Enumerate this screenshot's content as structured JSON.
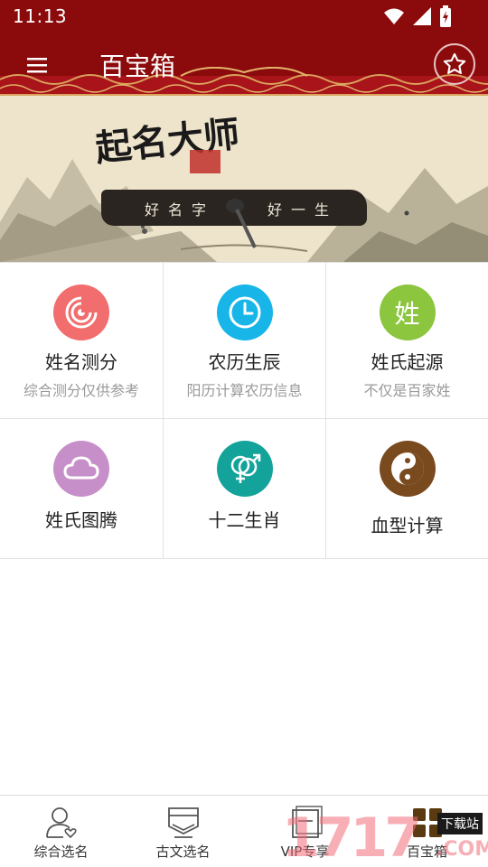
{
  "status_bar": {
    "time": "11:13",
    "icons": [
      "wifi-icon",
      "signal-icon",
      "battery-charging-icon"
    ]
  },
  "app_bar": {
    "title": "百宝箱",
    "menu_icon": "hamburger-menu-icon",
    "favorite_icon": "star-icon"
  },
  "banner": {
    "calligraphy": "起名大师",
    "slogan_left": "好名字",
    "slogan_right": "好一生"
  },
  "tools": [
    {
      "label": "姓名测分",
      "sub": "综合测分仅供参考",
      "icon": "target-icon",
      "color": "#f26d6d"
    },
    {
      "label": "农历生辰",
      "sub": "阳历计算农历信息",
      "icon": "clock-icon",
      "color": "#17b5e8"
    },
    {
      "label": "姓氏起源",
      "sub": "不仅是百家姓",
      "icon": "surname-char-icon",
      "icon_text": "姓",
      "color": "#8cc63f"
    },
    {
      "label": "姓氏图腾",
      "sub": "",
      "icon": "cloud-icon",
      "color": "#c78fc9"
    },
    {
      "label": "十二生肖",
      "sub": "",
      "icon": "gender-symbols-icon",
      "color": "#14a39a"
    },
    {
      "label": "血型计算",
      "sub": "",
      "icon": "yin-yang-icon",
      "color": "#7a4a1f"
    }
  ],
  "bottom_nav": [
    {
      "label": "综合选名",
      "icon": "user-heart-icon"
    },
    {
      "label": "古文选名",
      "icon": "scroll-icon"
    },
    {
      "label": "VIP专享",
      "icon": "vip-book-icon"
    },
    {
      "label": "百宝箱",
      "icon": "toolbox-grid-icon",
      "active": true
    }
  ],
  "watermark": {
    "text": "1717",
    "site_text": "下载站",
    "suffix": ".COM"
  },
  "colors": {
    "primary": "#8b0a0c",
    "divider": "#e1e1e1"
  }
}
